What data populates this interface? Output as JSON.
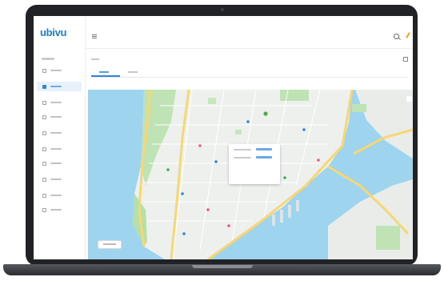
{
  "app": {
    "logo_text": "ubivu"
  },
  "sidebar": {
    "section_label": "",
    "items": [
      {
        "label": "",
        "icon": "document-icon",
        "active": false
      },
      {
        "label": "",
        "icon": "map-icon",
        "active": true
      },
      {
        "label": "",
        "icon": "route-icon",
        "active": false
      },
      {
        "label": "",
        "icon": "vehicle-icon",
        "active": false
      },
      {
        "label": "",
        "icon": "list-icon",
        "active": false
      },
      {
        "label": "",
        "icon": "list-icon",
        "active": false
      },
      {
        "label": "",
        "icon": "chat-icon",
        "active": false
      },
      {
        "label": "",
        "icon": "grid-icon",
        "active": false
      },
      {
        "label": "",
        "icon": "user-icon",
        "active": false
      },
      {
        "label": "",
        "icon": "settings-icon",
        "active": false
      }
    ]
  },
  "topbar": {
    "menu_icon": "hamburger-icon",
    "search_icon": "search-icon",
    "edit_icon": "pencil-icon",
    "avatar_icon": "avatar"
  },
  "page": {
    "title": "",
    "tabs": [
      {
        "label": "",
        "active": true
      },
      {
        "label": "",
        "active": false
      }
    ]
  },
  "map": {
    "popup": {
      "rows": [
        {
          "label": "",
          "value": ""
        },
        {
          "label": "",
          "value": ""
        }
      ]
    },
    "bottom_button_label": ""
  },
  "colors": {
    "accent": "#2f84d5",
    "water": "#9fd4ee",
    "land": "#eef0ee",
    "park": "#bfe3b4",
    "highway": "#f7d774"
  }
}
